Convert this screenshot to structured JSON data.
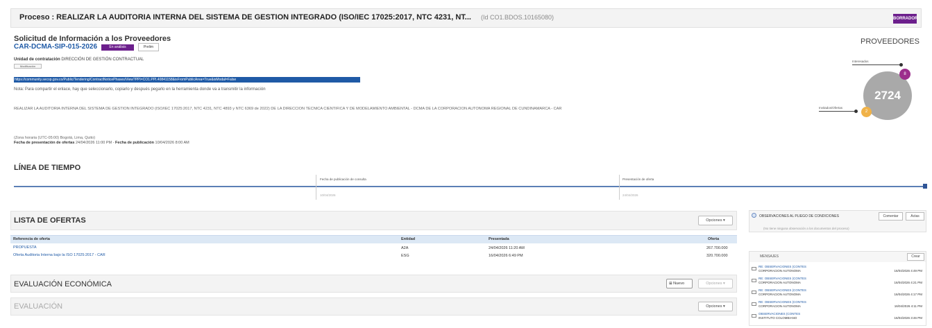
{
  "header": {
    "title": "Proceso : REALIZAR LA AUDITORIA INTERNA DEL SISTEMA DE GESTION INTEGRADO (ISO/IEC 17025:2017, NTC 4231, NT...",
    "id": "(Id CO1.BDOS.10165080)",
    "badge": "BORRADOR",
    "badge_color": "#6c1f8c"
  },
  "solicitud": {
    "title": "Solicitud de Información a los Proveedores",
    "code": "CAR-DCMA-SIP-015-2026",
    "status": "En análisis",
    "btn": "Prelim",
    "unidad_label": "Unidad de contratación",
    "unidad_value": "DIRECCIÓN DE GESTIÓN CONTRACTUAL",
    "unidad_tag": "Modificación",
    "link": "https://community.secop.gov.co/Public/Tendering/ContractNoticePhases/View?PPI=CO1.PPI.40841158&isFromPublicArea=True&isModal=False",
    "nota": "Nota: Para compartir el enlace, hay que seleccionarlo, copiarlo y después pegarlo en la herramienta donde va a transmitir la información",
    "description": "REALIZAR LA AUDITORIA INTERNA DEL SISTEMA DE GESTION INTEGRADO (ISO/IEC 17025:2017, NTC 4231, NTC 4893 y NTC 6369 de 2022) DE LA DIRECCION TECNICA CIENTIFICA Y DE MODELAMIENTO AMBIENTAL - DCMA DE LA CORPORACION AUTONOMA REGIONAL DE CUNDINAMARCA - CAR",
    "zona": "(Zona horaria (UTC-05:00) Bogotá, Lima, Quito)",
    "fecha_pres_label": "Fecha de presentación de ofertas",
    "fecha_pres_value": "24/04/2026 11:00 PM",
    "fecha_pub_label": "Fecha de publicación",
    "fecha_pub_value": "10/04/2026 8:00 AM"
  },
  "proveedores": {
    "title": "PROVEEDORES",
    "label1": "Interesados",
    "label2": "Invitados/Ofertas",
    "count": "2724",
    "small1": "8",
    "small2": "2"
  },
  "timeline": {
    "title": "LÍNEA DE TIEMPO",
    "label1": "Fecha de publicación de consulta",
    "label2": "Presentación de oferta",
    "date1": "10/04/2026",
    "date2": "24/04/2026"
  },
  "lista_ofertas": {
    "title": "LISTA DE OFERTAS",
    "options": "Opciones ▾",
    "columns": [
      "Referencia de oferta",
      "Entidad",
      "Presentada",
      "Oferta"
    ],
    "rows": [
      [
        "PROPUESTA",
        "A2A",
        "24/04/2026 11:20 AM",
        "267.700.000"
      ],
      [
        "Oferta Auditoria Interna bajo la ISO 17025:2017 - CAR",
        "ESG",
        "16/04/2026 6:49 PM",
        "320.700.000"
      ]
    ]
  },
  "evaluacion_economica": {
    "title": "EVALUACIÓN ECONÓMICA",
    "nuevo": "Nuevo",
    "options": "Opciones ▾"
  },
  "evaluacion": {
    "title": "EVALUACIÓN",
    "options": "Opciones ▾"
  },
  "observaciones": {
    "title": "OBSERVACIONES AL PLIEGO DE CONDICIONES",
    "btn1": "Comentar",
    "btn2": "Actas",
    "note": "(No tiene ninguna observación a los documentos del proceso)"
  },
  "mensajes": {
    "title": "MENSAJES",
    "btn": "Crear",
    "items": [
      {
        "subject": "RE: OBSERVACIONES (CONTES",
        "from": "CORPORACION AUTONOMA",
        "date": "16/04/2026 4:49 PM"
      },
      {
        "subject": "RE: OBSERVACIONES (CONTES",
        "from": "CORPORACION AUTONOMA",
        "date": "16/04/2026 4:21 PM"
      },
      {
        "subject": "RE: OBSERVACIONES (CONTES",
        "from": "CORPORACION AUTONOMA",
        "date": "16/04/2026 4:17 PM"
      },
      {
        "subject": "RE: OBSERVACIONES (CONTES",
        "from": "CORPORACION AUTONOMA",
        "date": "16/04/2026 4:11 PM"
      },
      {
        "subject": "OBSERVACIONES (CONTES",
        "from": "INSTITUTO COLOMBIANO",
        "date": "16/04/2026 3:46 PM"
      }
    ]
  }
}
